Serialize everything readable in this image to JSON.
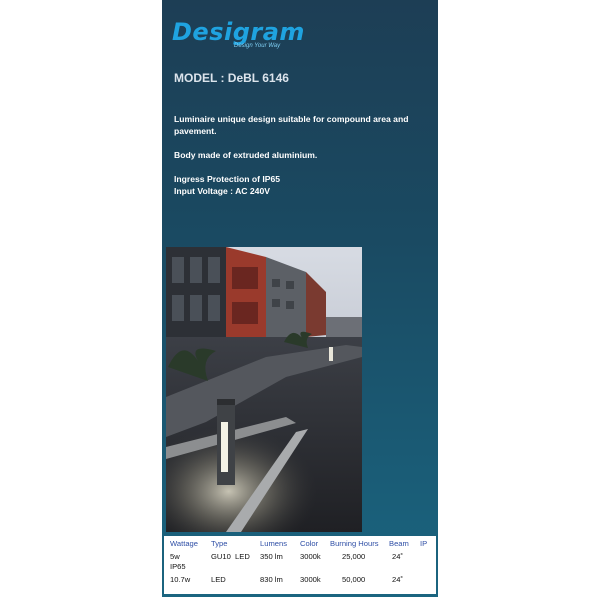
{
  "brand": {
    "name": "Desigram",
    "tagline": "Design Your Way"
  },
  "model": "MODEL : DeBL 6146",
  "description": [
    "Luminaire unique design suitable for compound area and pavement.",
    "Body made of extruded aluminium.",
    "Ingress Protection of IP65\nInput Voltage : AC 240V"
  ],
  "photo": {
    "alt": "Bollard lights along a pavement beside a building at dusk"
  },
  "specs": {
    "headers": [
      "Wattage",
      "Type",
      "Lumens",
      "Color",
      "Burning Hours",
      "Beam",
      "IP"
    ],
    "rows": [
      {
        "wattage": "5w",
        "type": "GU10  LED",
        "lumens": "350 lm",
        "color": "3000k",
        "hours": "25,000",
        "beam": "24˚",
        "ip": "IP65"
      },
      {
        "wattage": "10.7w",
        "type": "LED",
        "lumens": "830 lm",
        "color": "3000k",
        "hours": "50,000",
        "beam": "24˚",
        "ip": ""
      }
    ]
  },
  "colors": {
    "brand": "#1fa3e0",
    "panel_top": "#1d3e55",
    "panel_bottom": "#1b6580",
    "header_text": "#2f4fa6"
  }
}
